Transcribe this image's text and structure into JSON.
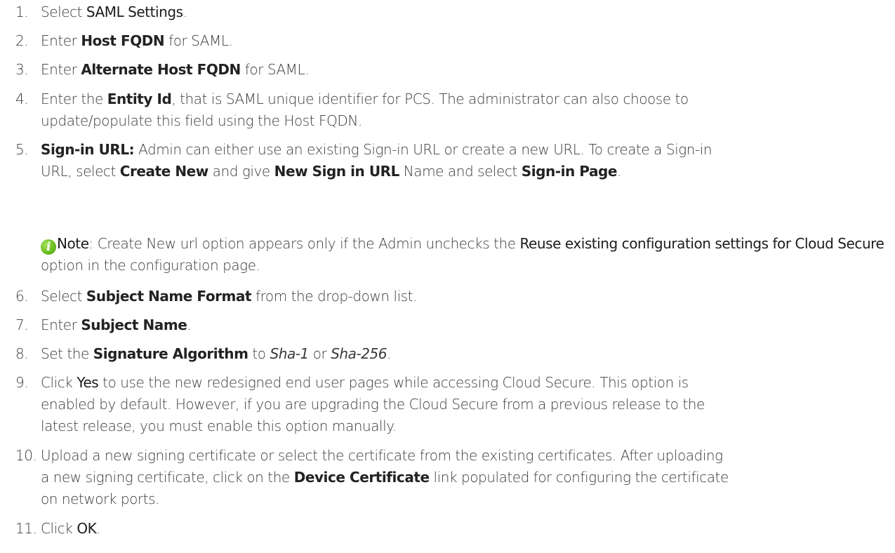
{
  "steps": [
    {
      "num": "1.",
      "a": "Select ",
      "b": "SAML Settings",
      "c": "."
    },
    {
      "num": "2.",
      "a": "Enter ",
      "b": "Host FQDN",
      "c": " for SAML."
    },
    {
      "num": "3.",
      "a": "Enter ",
      "b": "Alternate Host FQDN",
      "c": " for SAML."
    },
    {
      "num": "4.",
      "a": "Enter the ",
      "b": "Entity Id",
      "c": ", that is SAML unique identifier for PCS. The administrator can also choose to",
      "line2": "update/populate this field using the Host FQDN."
    },
    {
      "num": "5.",
      "b1": "Sign-in URL:",
      "a1": " Admin can either use an existing Sign-in URL or create a new URL. To create a Sign-in",
      "a2": "URL, select ",
      "b2": "Create New",
      "a3": " and give ",
      "b3": "New Sign in URL",
      "a4": " Name and select ",
      "b4": "Sign-in Page",
      "a5": "."
    },
    {
      "num": "6.",
      "a": "Select ",
      "b": "Subject Name Format",
      "c": " from the drop-down list."
    },
    {
      "num": "7.",
      "a": "Enter ",
      "b": "Subject Name",
      "c": "."
    },
    {
      "num": "8.",
      "a": "Set the ",
      "b": "Signature Algorithm",
      "c": " to ",
      "i1": "Sha-1",
      "d": " or ",
      "i2": "Sha-256",
      "e": "."
    },
    {
      "num": "9.",
      "a": "Click ",
      "ui": "Yes",
      "c": " to use the new redesigned end user pages while accessing Cloud Secure. This option is",
      "line2": "enabled by default. However, if you are upgrading the Cloud Secure from a previous release to the",
      "line3": "latest release, you must enable this option manually."
    },
    {
      "num": "10.",
      "line1": "Upload a new signing certificate or select the certificate from the existing certificates. After uploading",
      "line2a": "a new signing certificate, click on the ",
      "b": "Device Certificate",
      "line2b": " link populated for configuring the certificate",
      "line3": "on network ports."
    },
    {
      "num": "11.",
      "a": "Click ",
      "ui": "OK",
      "c": "."
    }
  ],
  "note": {
    "icon": "info-icon",
    "label": "Note",
    "text1": ": Create New url option appears only if the Admin unchecks the ",
    "ui": "Reuse existing configuration settings for Cloud Secure",
    "text2": " option in the configuration page."
  }
}
